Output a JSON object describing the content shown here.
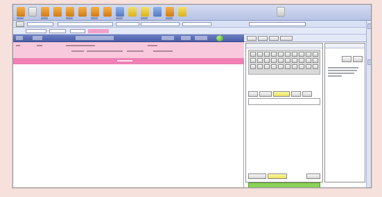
{
  "colors": {
    "page_background": "#f7e1dc",
    "toolbar": "#c4cfee",
    "header_bar": "#5568b3",
    "selected_row": "#f8c9dd",
    "highlight_bar": "#ef7fb5",
    "green_button": "#8bd25a",
    "yellow_button": "#f2ea7c",
    "input_pink": "#f1a1c9"
  },
  "toolbar": {
    "icons": [
      "toolbar-icon-1",
      "toolbar-icon-2",
      "toolbar-icon-3",
      "toolbar-icon-4",
      "toolbar-icon-5",
      "toolbar-icon-6",
      "toolbar-icon-7",
      "toolbar-icon-8",
      "toolbar-icon-9",
      "toolbar-icon-10",
      "toolbar-icon-11",
      "toolbar-icon-12",
      "toolbar-icon-13",
      "toolbar-icon-14",
      "toolbar-icon-15"
    ]
  },
  "record_bar": {
    "fields": [
      "",
      "",
      "",
      "",
      "",
      "",
      "",
      ""
    ]
  },
  "list": {
    "columns": [
      "",
      "",
      "",
      "",
      "",
      "",
      ""
    ],
    "rows": [
      {
        "cells": [
          "",
          "",
          "",
          "",
          ""
        ]
      },
      {
        "cells": [
          "",
          "",
          "",
          "",
          "",
          ""
        ]
      }
    ]
  },
  "side_panel": {
    "tabs": [
      "",
      "",
      "",
      ""
    ],
    "input_title": "",
    "memo_title": "",
    "memo_buttons": [
      "",
      ""
    ]
  }
}
